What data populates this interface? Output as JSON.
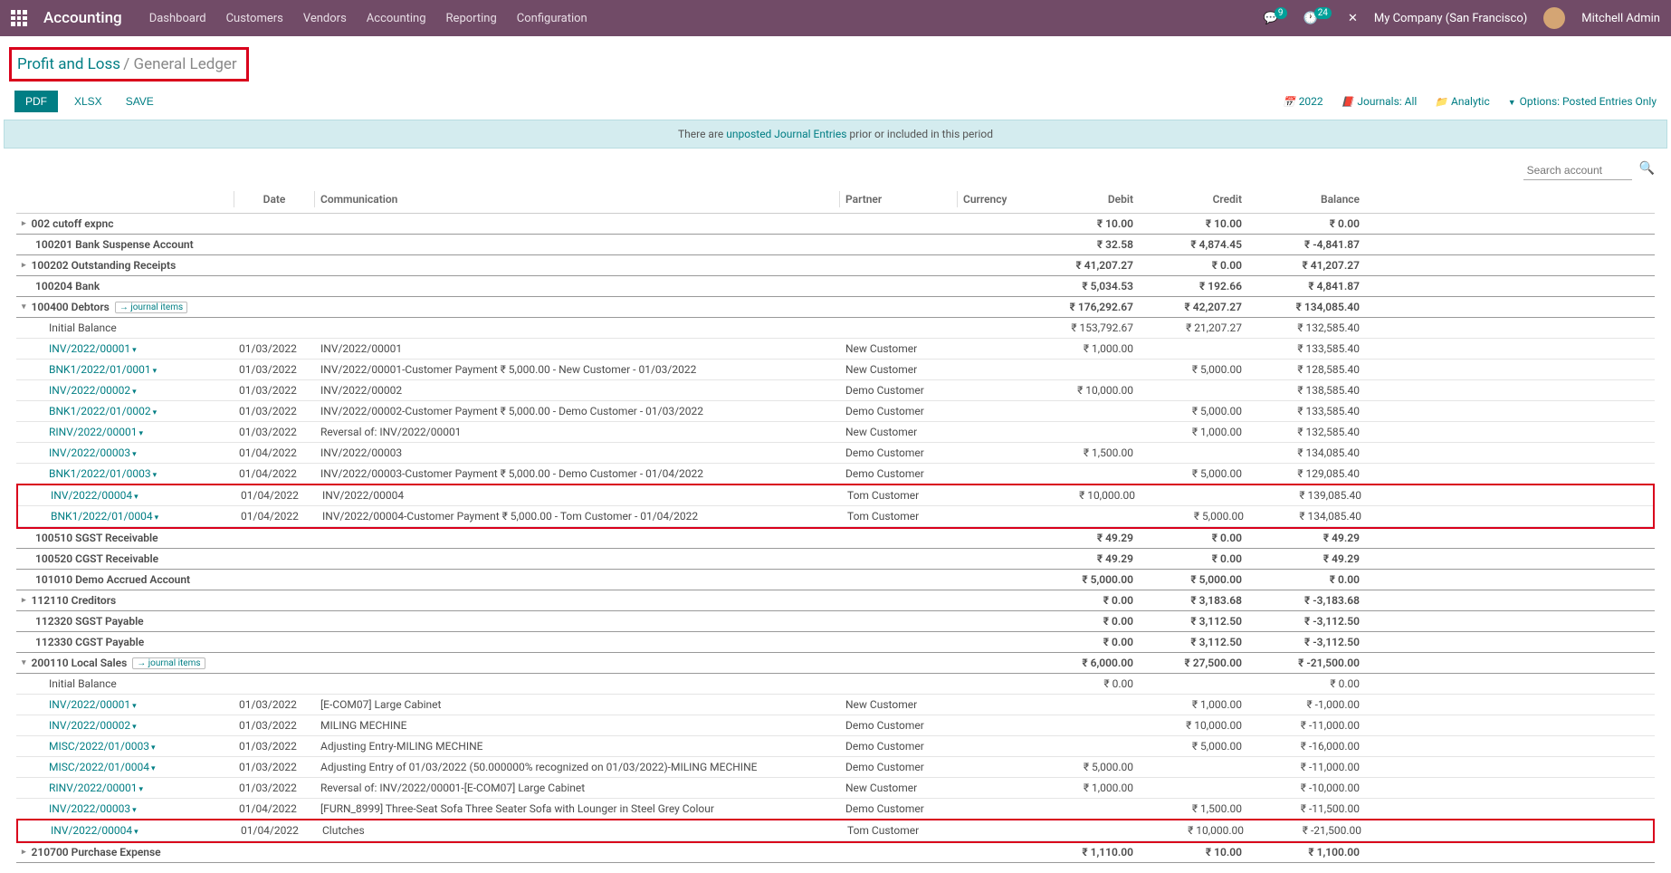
{
  "nav": {
    "app": "Accounting",
    "menu": [
      "Dashboard",
      "Customers",
      "Vendors",
      "Accounting",
      "Reporting",
      "Configuration"
    ],
    "msg_badge": "9",
    "act_badge": "24",
    "company": "My Company (San Francisco)",
    "user": "Mitchell Admin"
  },
  "breadcrumb": {
    "parent": "Profit and Loss",
    "current": "General Ledger"
  },
  "buttons": {
    "pdf": "PDF",
    "xlsx": "XLSX",
    "save": "SAVE"
  },
  "filters": {
    "year": "2022",
    "journals": "Journals: All",
    "analytic": "Analytic",
    "options": "Options: Posted Entries Only"
  },
  "banner": {
    "pre": "There are ",
    "link": "unposted Journal Entries",
    "post": " prior or included in this period"
  },
  "search_ph": "Search account",
  "headers": {
    "date": "Date",
    "comm": "Communication",
    "partner": "Partner",
    "curr": "Currency",
    "debit": "Debit",
    "credit": "Credit",
    "balance": "Balance"
  },
  "ji_label": "→ journal items",
  "accounts": [
    {
      "name": "002 cutoff expnc",
      "caret": "▸",
      "debit": "₹ 10.00",
      "credit": "₹ 10.00",
      "balance": "₹ 0.00"
    },
    {
      "name": "100201 Bank Suspense Account",
      "debit": "₹ 32.58",
      "credit": "₹ 4,874.45",
      "balance": "₹ -4,841.87"
    },
    {
      "name": "100202 Outstanding Receipts",
      "caret": "▸",
      "debit": "₹ 41,207.27",
      "credit": "₹ 0.00",
      "balance": "₹ 41,207.27"
    },
    {
      "name": "100204 Bank",
      "debit": "₹ 5,034.53",
      "credit": "₹ 192.66",
      "balance": "₹ 4,841.87"
    }
  ],
  "debtors": {
    "name": "100400 Debtors",
    "caret": "▾",
    "ji": true,
    "debit": "₹ 176,292.67",
    "credit": "₹ 42,207.27",
    "balance": "₹ 134,085.40",
    "initial": {
      "label": "Initial Balance",
      "debit": "₹ 153,792.67",
      "credit": "₹ 21,207.27",
      "balance": "₹ 132,585.40"
    },
    "lines": [
      {
        "ref": "INV/2022/00001",
        "date": "01/03/2022",
        "comm": "INV/2022/00001",
        "partner": "New Customer",
        "debit": "₹ 1,000.00",
        "credit": "",
        "balance": "₹ 133,585.40"
      },
      {
        "ref": "BNK1/2022/01/0001",
        "date": "01/03/2022",
        "comm": "INV/2022/00001-Customer Payment ₹ 5,000.00 - New Customer - 01/03/2022",
        "partner": "New Customer",
        "debit": "",
        "credit": "₹ 5,000.00",
        "balance": "₹ 128,585.40"
      },
      {
        "ref": "INV/2022/00002",
        "date": "01/03/2022",
        "comm": "INV/2022/00002",
        "partner": "Demo Customer",
        "debit": "₹ 10,000.00",
        "credit": "",
        "balance": "₹ 138,585.40"
      },
      {
        "ref": "BNK1/2022/01/0002",
        "date": "01/03/2022",
        "comm": "INV/2022/00002-Customer Payment ₹ 5,000.00 - Demo Customer - 01/03/2022",
        "partner": "Demo Customer",
        "debit": "",
        "credit": "₹ 5,000.00",
        "balance": "₹ 133,585.40"
      },
      {
        "ref": "RINV/2022/00001",
        "date": "01/03/2022",
        "comm": "Reversal of: INV/2022/00001",
        "partner": "New Customer",
        "debit": "",
        "credit": "₹ 1,000.00",
        "balance": "₹ 132,585.40"
      },
      {
        "ref": "INV/2022/00003",
        "date": "01/04/2022",
        "comm": "INV/2022/00003",
        "partner": "Demo Customer",
        "debit": "₹ 1,500.00",
        "credit": "",
        "balance": "₹ 134,085.40"
      },
      {
        "ref": "BNK1/2022/01/0003",
        "date": "01/04/2022",
        "comm": "INV/2022/00003-Customer Payment ₹ 5,000.00 - Demo Customer - 01/04/2022",
        "partner": "Demo Customer",
        "debit": "",
        "credit": "₹ 5,000.00",
        "balance": "₹ 129,085.40"
      }
    ],
    "hl": [
      {
        "ref": "INV/2022/00004",
        "date": "01/04/2022",
        "comm": "INV/2022/00004",
        "partner": "Tom Customer",
        "debit": "₹ 10,000.00",
        "credit": "",
        "balance": "₹ 139,085.40"
      },
      {
        "ref": "BNK1/2022/01/0004",
        "date": "01/04/2022",
        "comm": "INV/2022/00004-Customer Payment ₹ 5,000.00 - Tom Customer - 01/04/2022",
        "partner": "Tom Customer",
        "debit": "",
        "credit": "₹ 5,000.00",
        "balance": "₹ 134,085.40"
      }
    ]
  },
  "mid_accounts": [
    {
      "name": "100510 SGST Receivable",
      "debit": "₹ 49.29",
      "credit": "₹ 0.00",
      "balance": "₹ 49.29"
    },
    {
      "name": "100520 CGST Receivable",
      "debit": "₹ 49.29",
      "credit": "₹ 0.00",
      "balance": "₹ 49.29"
    },
    {
      "name": "101010 Demo Accrued Account",
      "debit": "₹ 5,000.00",
      "credit": "₹ 5,000.00",
      "balance": "₹ 0.00"
    },
    {
      "name": "112110 Creditors",
      "caret": "▸",
      "debit": "₹ 0.00",
      "credit": "₹ 3,183.68",
      "balance": "₹ -3,183.68"
    },
    {
      "name": "112320 SGST Payable",
      "debit": "₹ 0.00",
      "credit": "₹ 3,112.50",
      "balance": "₹ -3,112.50"
    },
    {
      "name": "112330 CGST Payable",
      "debit": "₹ 0.00",
      "credit": "₹ 3,112.50",
      "balance": "₹ -3,112.50"
    }
  ],
  "local": {
    "name": "200110 Local Sales",
    "caret": "▾",
    "ji": true,
    "debit": "₹ 6,000.00",
    "credit": "₹ 27,500.00",
    "balance": "₹ -21,500.00",
    "initial": {
      "label": "Initial Balance",
      "debit": "₹ 0.00",
      "credit": "",
      "balance": "₹ 0.00"
    },
    "lines": [
      {
        "ref": "INV/2022/00001",
        "date": "01/03/2022",
        "comm": "[E-COM07] Large Cabinet",
        "partner": "New Customer",
        "debit": "",
        "credit": "₹ 1,000.00",
        "balance": "₹ -1,000.00"
      },
      {
        "ref": "INV/2022/00002",
        "date": "01/03/2022",
        "comm": "MILING MECHINE",
        "partner": "Demo Customer",
        "debit": "",
        "credit": "₹ 10,000.00",
        "balance": "₹ -11,000.00"
      },
      {
        "ref": "MISC/2022/01/0003",
        "date": "01/03/2022",
        "comm": "Adjusting Entry-MILING MECHINE",
        "partner": "Demo Customer",
        "debit": "",
        "credit": "₹ 5,000.00",
        "balance": "₹ -16,000.00"
      },
      {
        "ref": "MISC/2022/01/0004",
        "date": "01/03/2022",
        "comm": "Adjusting Entry of 01/03/2022 (50.000000% recognized on 01/03/2022)-MILING MECHINE",
        "partner": "Demo Customer",
        "debit": "₹ 5,000.00",
        "credit": "",
        "balance": "₹ -11,000.00"
      },
      {
        "ref": "RINV/2022/00001",
        "date": "01/03/2022",
        "comm": "Reversal of: INV/2022/00001-[E-COM07] Large Cabinet",
        "partner": "New Customer",
        "debit": "₹ 1,000.00",
        "credit": "",
        "balance": "₹ -10,000.00"
      },
      {
        "ref": "INV/2022/00003",
        "date": "01/04/2022",
        "comm": "[FURN_8999] Three-Seat Sofa Three Seater Sofa with Lounger in Steel Grey Colour",
        "partner": "Demo Customer",
        "debit": "",
        "credit": "₹ 1,500.00",
        "balance": "₹ -11,500.00"
      }
    ],
    "hl": [
      {
        "ref": "INV/2022/00004",
        "date": "01/04/2022",
        "comm": "Clutches",
        "partner": "Tom Customer",
        "debit": "",
        "credit": "₹ 10,000.00",
        "balance": "₹ -21,500.00"
      }
    ]
  },
  "last": {
    "name": "210700 Purchase Expense",
    "caret": "▸",
    "debit": "₹ 1,110.00",
    "credit": "₹ 10.00",
    "balance": "₹ 1,100.00"
  }
}
